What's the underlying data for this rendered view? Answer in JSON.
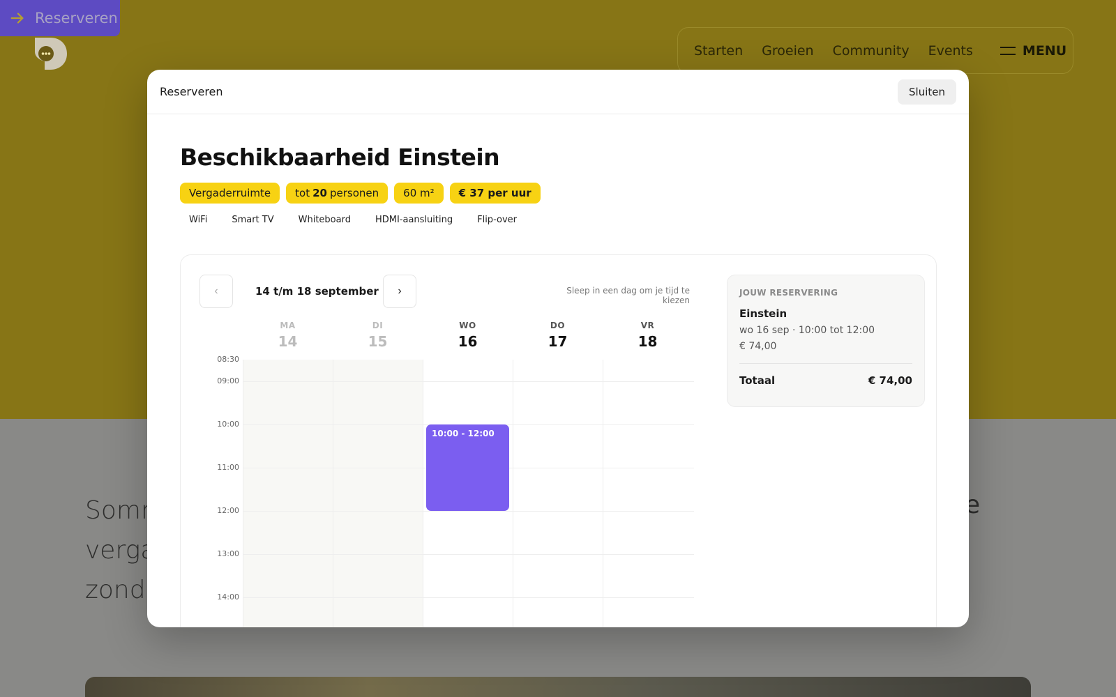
{
  "background": {
    "skip_label": "Reserveren",
    "nav": [
      "Starten",
      "Groeien",
      "Community",
      "Events"
    ],
    "menu_label": "MENU",
    "text_lines": [
      "Somm",
      "verga",
      "zonde"
    ],
    "text_right": "e"
  },
  "modal": {
    "title": "Reserveren",
    "close_label": "Sluiten",
    "heading": "Beschikbaarheid Einstein",
    "tags": {
      "type": "Vergaderruimte",
      "capacity_prefix": "tot",
      "capacity_value": "20",
      "capacity_suffix": "personen",
      "area": "60 m²",
      "price": "€ 37 per uur"
    },
    "amenities": [
      "WiFi",
      "Smart TV",
      "Whiteboard",
      "HDMI-aansluiting",
      "Flip-over"
    ],
    "calendar": {
      "prev": "‹",
      "next": "›",
      "week_label": "14 t/m 18 september",
      "hint": "Sleep in een dag om je tijd te kiezen",
      "days": [
        {
          "name": "MA",
          "date": "14",
          "past": true
        },
        {
          "name": "DI",
          "date": "15",
          "past": true
        },
        {
          "name": "WO",
          "date": "16",
          "past": false
        },
        {
          "name": "DO",
          "date": "17",
          "past": false
        },
        {
          "name": "VR",
          "date": "18",
          "past": false
        }
      ],
      "times": [
        "08:30",
        "09:00",
        "10:00",
        "11:00",
        "12:00",
        "13:00",
        "14:00"
      ],
      "event": {
        "label": "10:00 - 12:00",
        "day_index": 2,
        "start": "10:00",
        "end": "12:00"
      }
    },
    "summary": {
      "title": "JOUW RESERVERING",
      "room": "Einstein",
      "when": "wo 16 sep · 10:00 tot 12:00",
      "price": "€ 74,00",
      "total_label": "Totaal",
      "total_value": "€ 74,00"
    },
    "colors": {
      "accent": "#7b5ef0",
      "tag": "#f7d213"
    }
  }
}
